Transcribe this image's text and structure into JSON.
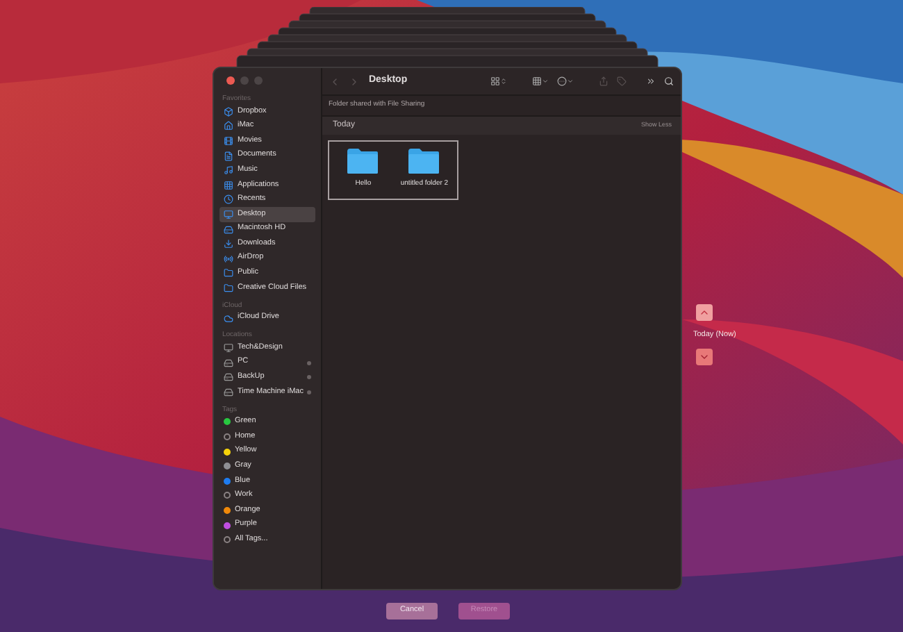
{
  "window": {
    "title": "Desktop"
  },
  "sidebar": {
    "sections": [
      {
        "title": "Favorites",
        "items": [
          {
            "label": "Dropbox",
            "selected": false
          },
          {
            "label": "iMac",
            "selected": false
          },
          {
            "label": "Movies",
            "selected": false
          },
          {
            "label": "Documents",
            "selected": false
          },
          {
            "label": "Music",
            "selected": false
          },
          {
            "label": "Applications",
            "selected": false
          },
          {
            "label": "Recents",
            "selected": false
          },
          {
            "label": "Desktop",
            "selected": true
          },
          {
            "label": "Macintosh HD",
            "selected": false
          },
          {
            "label": "Downloads",
            "selected": false
          },
          {
            "label": "AirDrop",
            "selected": false
          },
          {
            "label": "Public",
            "selected": false
          },
          {
            "label": "Creative Cloud Files",
            "selected": false
          }
        ]
      },
      {
        "title": "iCloud",
        "items": [
          {
            "label": "iCloud Drive",
            "selected": false
          }
        ]
      },
      {
        "title": "Locations",
        "items": [
          {
            "label": "Tech&Design",
            "selected": false,
            "ejectable": false
          },
          {
            "label": "PC",
            "selected": false,
            "ejectable": true
          },
          {
            "label": "BackUp",
            "selected": false,
            "ejectable": true
          },
          {
            "label": "Time Machine iMac",
            "selected": false,
            "ejectable": true
          }
        ]
      },
      {
        "title": "Tags",
        "items": [
          {
            "label": "Green",
            "kind": "tag",
            "color": "#28c840"
          },
          {
            "label": "Home",
            "kind": "tag"
          },
          {
            "label": "Yellow",
            "kind": "tag",
            "color": "#f5d20a"
          },
          {
            "label": "Gray",
            "kind": "tag",
            "color": "#8e8e93"
          },
          {
            "label": "Blue",
            "kind": "tag",
            "color": "#1e7cf0"
          },
          {
            "label": "Work",
            "kind": "tag"
          },
          {
            "label": "Orange",
            "kind": "tag",
            "color": "#f0890a"
          },
          {
            "label": "Purple",
            "kind": "tag",
            "color": "#c04ee0"
          },
          {
            "label": "All Tags...",
            "kind": "tag"
          }
        ]
      }
    ]
  },
  "content": {
    "banner": "Folder shared with File Sharing",
    "group": "Today",
    "group_action": "Show Less",
    "files": [
      {
        "name": "Hello",
        "selected": true
      },
      {
        "name": "untitled folder 2",
        "selected": true
      }
    ]
  },
  "timeline": {
    "label": "Today (Now)"
  },
  "buttons": [
    {
      "label": "Cancel",
      "disabled": false
    },
    {
      "label": "Restore",
      "disabled": true
    }
  ]
}
